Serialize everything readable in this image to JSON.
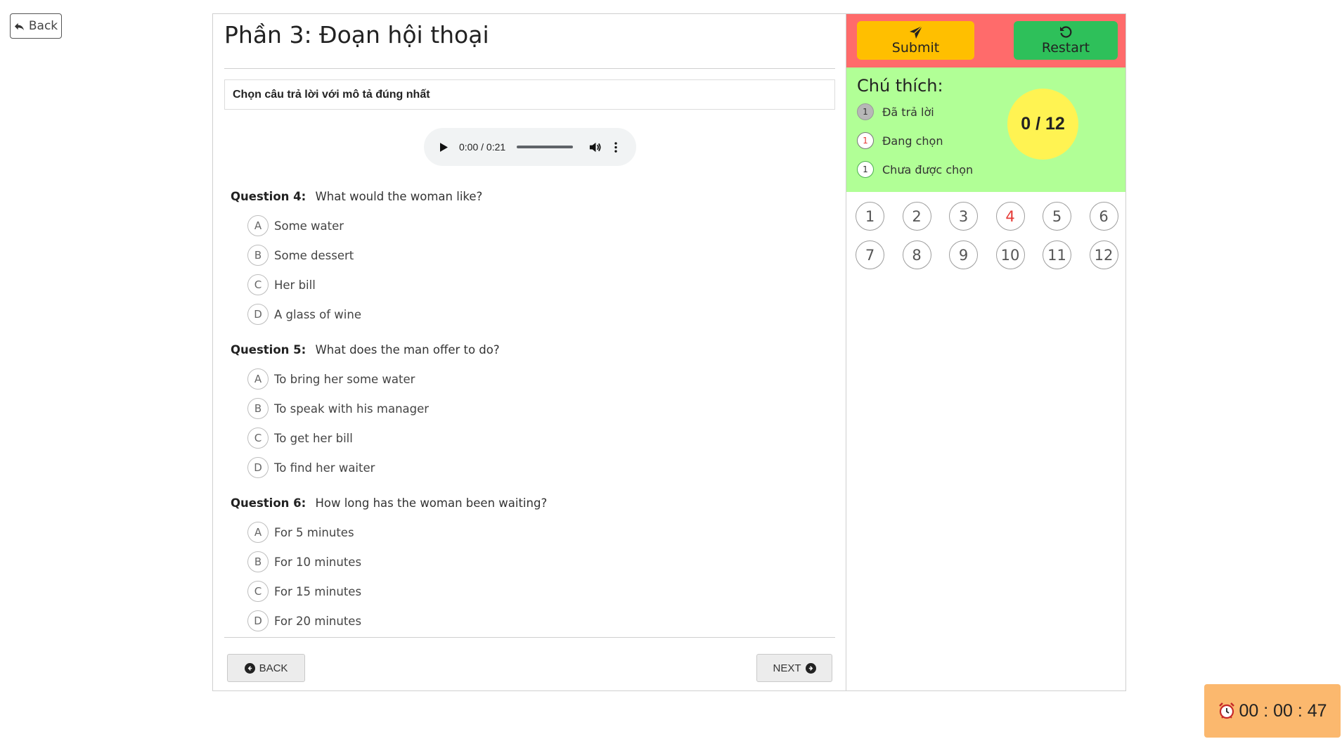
{
  "top_back": {
    "label": "Back"
  },
  "page": {
    "title": "Phần 3: Đoạn hội thoại",
    "instruction": "Chọn câu trả lời với mô tả đúng nhất"
  },
  "audio": {
    "time": "0:00 / 0:21"
  },
  "questions": [
    {
      "label": "Question 4:",
      "text": "What would the woman like?",
      "options": [
        {
          "letter": "A",
          "text": "Some water"
        },
        {
          "letter": "B",
          "text": "Some dessert"
        },
        {
          "letter": "C",
          "text": "Her bill"
        },
        {
          "letter": "D",
          "text": "A glass of wine"
        }
      ]
    },
    {
      "label": "Question 5:",
      "text": "What does the man offer to do?",
      "options": [
        {
          "letter": "A",
          "text": "To bring her some water"
        },
        {
          "letter": "B",
          "text": "To speak with his manager"
        },
        {
          "letter": "C",
          "text": "To get her bill"
        },
        {
          "letter": "D",
          "text": "To find her waiter"
        }
      ]
    },
    {
      "label": "Question 6:",
      "text": "How long has the woman been waiting?",
      "options": [
        {
          "letter": "A",
          "text": "For 5 minutes"
        },
        {
          "letter": "B",
          "text": "For 10 minutes"
        },
        {
          "letter": "C",
          "text": "For 15 minutes"
        },
        {
          "letter": "D",
          "text": "For 20 minutes"
        }
      ]
    }
  ],
  "nav": {
    "back_label": "BACK",
    "next_label": "NEXT"
  },
  "actions": {
    "submit_label": "Submit",
    "restart_label": "Restart"
  },
  "legend": {
    "title": "Chú thích:",
    "items": [
      {
        "num": "1",
        "label": "Đã trả lời"
      },
      {
        "num": "1",
        "label": "Đang chọn"
      },
      {
        "num": "1",
        "label": "Chưa được chọn"
      }
    ]
  },
  "score": "0 / 12",
  "question_numbers": [
    "1",
    "2",
    "3",
    "4",
    "5",
    "6",
    "7",
    "8",
    "9",
    "10",
    "11",
    "12"
  ],
  "current_question": "4",
  "timer": {
    "icon": "alarm-clock-icon",
    "value": "00 : 00 : 47"
  },
  "colors": {
    "action_bar": "#ff6b6b",
    "submit": "#ffbf00",
    "restart": "#2ec05a",
    "legend_bg": "#b1ff96",
    "score_bg": "#fff352",
    "timer_bg": "#fbb86e",
    "current": "#e53935"
  }
}
